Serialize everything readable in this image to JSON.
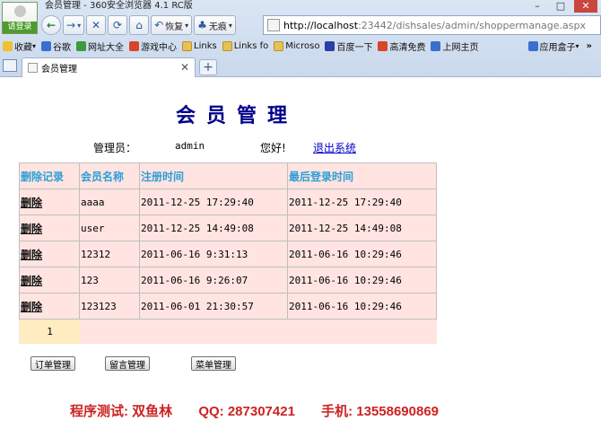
{
  "window": {
    "title": "会员管理 - 360安全浏览器 4.1 RC版",
    "login_badge": "请登录"
  },
  "toolbar": {
    "restore_label": "恢复",
    "no_ads_label": "无痕"
  },
  "address": {
    "host": "http://localhost",
    "path": ":23442/dishsales/admin/shoppermanage.aspx"
  },
  "favorites": {
    "items": [
      "收藏",
      "谷歌",
      "网址大全",
      "游戏中心",
      "Links",
      "Links fo",
      "Microso",
      "百度一下",
      "高清免费",
      "上网主页"
    ],
    "apps_label": "应用盒子"
  },
  "tab": {
    "title": "会员管理"
  },
  "page": {
    "title": "会员管理",
    "admin_label": "管理员：",
    "admin_name": "admin",
    "greeting": "您好!",
    "logout": "退出系统"
  },
  "table": {
    "headers": [
      "删除记录",
      "会员名称",
      "注册时间",
      "最后登录时间"
    ],
    "delete_label": "删除",
    "rows": [
      {
        "name": "aaaa",
        "registered": "2011-12-25 17:29:40",
        "last_login": "2011-12-25 17:29:40"
      },
      {
        "name": "user",
        "registered": "2011-12-25 14:49:08",
        "last_login": "2011-12-25 14:49:08"
      },
      {
        "name": "12312",
        "registered": "2011-06-16 9:31:13",
        "last_login": "2011-06-16 10:29:46"
      },
      {
        "name": "123",
        "registered": "2011-06-16 9:26:07",
        "last_login": "2011-06-16 10:29:46"
      },
      {
        "name": "123123",
        "registered": "2011-06-01 21:30:57",
        "last_login": "2011-06-16 10:29:46"
      }
    ],
    "page": "1"
  },
  "buttons": {
    "orders": "订单管理",
    "messages": "留言管理",
    "menu": "菜单管理"
  },
  "footer": {
    "tester": "程序测试: 双鱼林",
    "qq": "QQ: 287307421",
    "phone": "手机: 13558690869"
  },
  "colors": {
    "title": "#00008b",
    "header_text": "#2a9fd6",
    "table_bg": "#ffe4e1",
    "footer": "#cc2222"
  }
}
